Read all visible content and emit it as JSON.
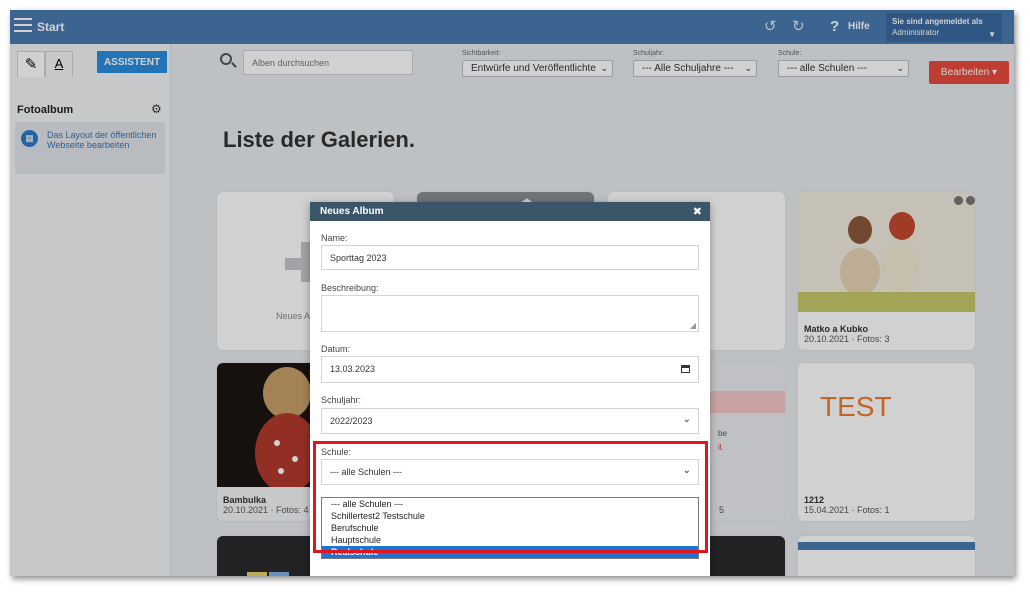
{
  "topbar": {
    "start_label": "Start",
    "help_label": "Hilfe",
    "user_line1": "Sie sind angemeldet als",
    "user_line2": "Administrator"
  },
  "sidebar": {
    "assistant_label": "ASSISTENT",
    "section_title": "Fotoalbum",
    "layout_link": "Das Layout der öffentlichen Webseite bearbeiten",
    "font_tab": "A"
  },
  "filters": {
    "search_placeholder": "Alben durchsuchen",
    "visibility_label": "Sichtbarkeit:",
    "visibility_value": "Entwürfe und Veröffentlichte",
    "year_label": "Schuljahr:",
    "year_value": "--- Alle Schuljahre ---",
    "school_label": "Schule:",
    "school_value": "--- alle Schulen ---",
    "edit_button": "Bearbeiten"
  },
  "page_title": "Liste der Galerien.",
  "cards": [
    {
      "new_label": "Neues A"
    },
    {
      "title": "Matko a Kubko",
      "meta": "20.10.2021 · Fotos: 3"
    },
    {
      "title": "Bambulka",
      "meta": "20.10.2021 · Fotos: 4"
    },
    {
      "title": "1212",
      "meta": "15.04.2021 · Fotos: 1",
      "thumb_text": "TEST"
    },
    {
      "meta_fragment": "5",
      "text_fragment_1": "be",
      "text_fragment_2": "il."
    }
  ],
  "dialog": {
    "title": "Neues Album",
    "name_label": "Name:",
    "name_value": "Sporttag 2023",
    "description_label": "Beschreibung:",
    "date_label": "Datum:",
    "date_value": "13.03.2023",
    "year_label": "Schuljahr:",
    "year_value": "2022/2023",
    "school_label": "Schule:",
    "school_value": "--- alle Schulen ---",
    "school_options": [
      "--- alle Schulen ---",
      "Schillertest2 Testschule",
      "Berufschule",
      "Hauptschule",
      "Realschule"
    ],
    "selected_option_index": 4
  },
  "colors": {
    "topbar": "#4a7ab0",
    "assistant_button": "#2a8ee0",
    "edit_button": "#e84a3c",
    "dialog_header": "#3b5668",
    "selected_option": "#1e74d6",
    "highlight_border": "#e0161c"
  }
}
